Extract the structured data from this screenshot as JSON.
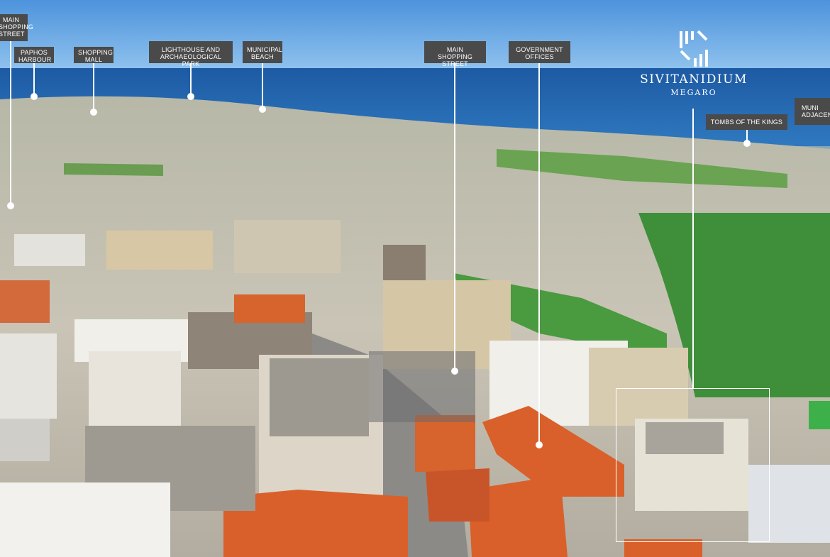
{
  "brand": {
    "name": "SIVITANIDIUM",
    "subtitle": "MEGARO",
    "logo_icon": "striped-s-logo-icon"
  },
  "labels": [
    {
      "id": "main-shopping-street-left",
      "text": "MAIN\nSHOPPING\nSTREET"
    },
    {
      "id": "paphos-harbour",
      "text": "PAPHOS\nHARBOUR"
    },
    {
      "id": "shopping-mall",
      "text": "SHOPPING\nMALL"
    },
    {
      "id": "lighthouse",
      "text": "LIGHTHOUSE AND\nARCHAEOLOGICAL PARK"
    },
    {
      "id": "municipal-beach",
      "text": "MUNICIPAL\nBEACH"
    },
    {
      "id": "main-shopping-street",
      "text": "MAIN\nSHOPPING STREET"
    },
    {
      "id": "government-offices",
      "text": "GOVERNMENT\nOFFICES"
    },
    {
      "id": "tombs-of-the-kings",
      "text": "TOMBS OF THE KINGS"
    },
    {
      "id": "municipal-adjacent",
      "text": "MUNI\nADJACENT"
    }
  ],
  "colors": {
    "label_bg": "#4a4a4a",
    "sky": "#5a9ee0",
    "sea": "#1f5fa8",
    "roof_orange": "#d9602a"
  }
}
